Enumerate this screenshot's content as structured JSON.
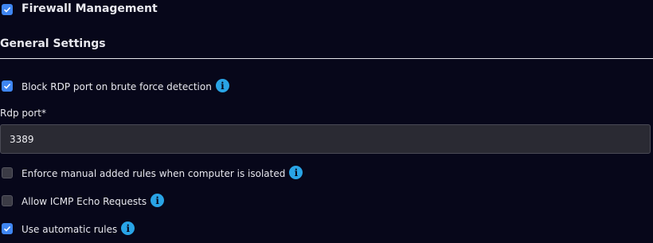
{
  "firewall": {
    "label": "Firewall Management",
    "checked": true
  },
  "general_settings": {
    "title": "General Settings"
  },
  "block_rdp": {
    "label": "Block RDP port on brute force detection",
    "checked": true,
    "info_icon": "i"
  },
  "rdp_port": {
    "label": "Rdp port*",
    "value": "3389"
  },
  "enforce_manual": {
    "label": "Enforce manual added rules when computer is isolated",
    "checked": false,
    "info_icon": "i"
  },
  "allow_icmp": {
    "label": "Allow ICMP Echo Requests",
    "checked": false,
    "info_icon": "i"
  },
  "auto_rules": {
    "label": "Use automatic rules",
    "checked": true,
    "info_icon": "i"
  },
  "colors": {
    "background": "#07071a",
    "accent": "#3f86f2",
    "info": "#29a4e6"
  }
}
